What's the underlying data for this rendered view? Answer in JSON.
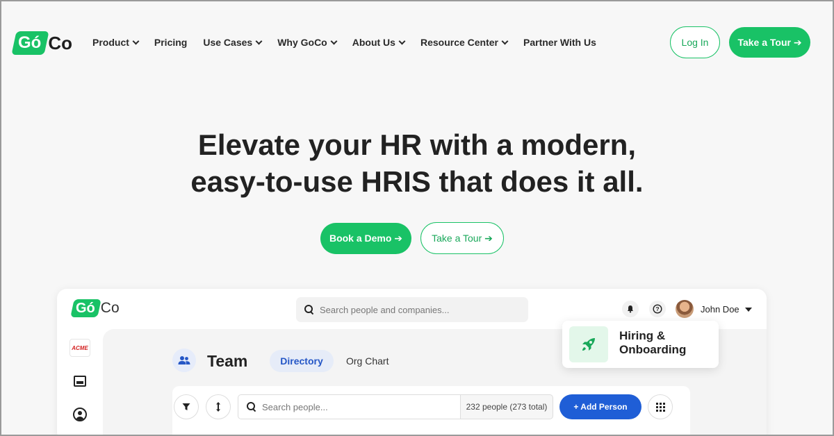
{
  "brand": {
    "logo_go": "Gó",
    "logo_co": "Co",
    "accent": "#19c266",
    "primary_blue": "#1f5ed6"
  },
  "nav": {
    "items": [
      {
        "label": "Product",
        "dropdown": true
      },
      {
        "label": "Pricing",
        "dropdown": false
      },
      {
        "label": "Use Cases",
        "dropdown": true
      },
      {
        "label": "Why GoCo",
        "dropdown": true
      },
      {
        "label": "About Us",
        "dropdown": true
      },
      {
        "label": "Resource Center",
        "dropdown": true
      },
      {
        "label": "Partner With Us",
        "dropdown": false
      }
    ],
    "login_label": "Log In",
    "tour_label": "Take a Tour ➔"
  },
  "hero": {
    "title_line1": "Elevate your HR with a modern,",
    "title_line2": "easy-to-use HRIS that does it all.",
    "demo_label": "Book a Demo ➔",
    "tour_label": "Take a Tour ➔"
  },
  "app": {
    "logo_go": "Gó",
    "logo_co": "Co",
    "search_placeholder": "Search people and companies...",
    "user_name": "John Doe",
    "sidebar_company": "ACME",
    "page_title": "Team",
    "tabs": [
      {
        "label": "Directory",
        "active": true
      },
      {
        "label": "Org Chart",
        "active": false
      }
    ],
    "people_search_placeholder": "Search people...",
    "people_count": "232 people (273 total)",
    "add_person_label": "+ Add Person"
  },
  "feature_card": {
    "line1": "Hiring &",
    "line2": "Onboarding"
  },
  "icons": {
    "bell": "bell-icon",
    "help": "help-icon",
    "filter": "filter-icon",
    "sort": "sort-icon",
    "grid": "grid-icon",
    "rocket": "rocket-icon",
    "team": "team-icon"
  }
}
